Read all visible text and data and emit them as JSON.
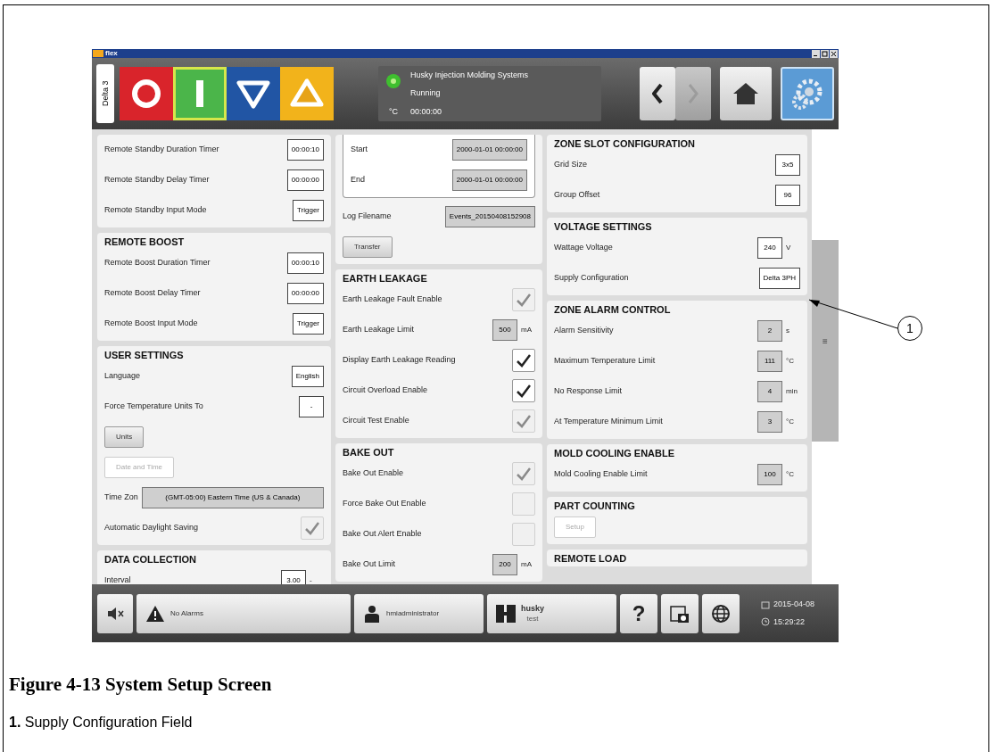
{
  "window": {
    "title": "flex",
    "controls": [
      {
        "kind": "minimize"
      },
      {
        "kind": "maximize"
      },
      {
        "kind": "close"
      }
    ]
  },
  "toolbar": {
    "machine_tab": "Delta 3",
    "mode_buttons": [
      {
        "kind": "stop",
        "selected": false
      },
      {
        "kind": "start",
        "selected": true
      },
      {
        "kind": "lower",
        "selected": false
      },
      {
        "kind": "raise",
        "selected": false
      }
    ],
    "status": {
      "led_on": true,
      "unit": "°C",
      "company": "Husky Injection Molding Systems",
      "state": "Running",
      "time": "00:00:00"
    },
    "nav_buttons": [
      {
        "kind": "back",
        "selected": false,
        "disabled": false
      },
      {
        "kind": "forward",
        "selected": false,
        "disabled": true
      },
      {
        "kind": "home",
        "selected": false,
        "disabled": false
      },
      {
        "kind": "settings",
        "selected": true,
        "disabled": false
      }
    ]
  },
  "columns": [
    {
      "sections": [
        {
          "rows": [
            {
              "kind": "field",
              "label": "Remote Standby Duration Timer",
              "value": "00:00:10",
              "readonly": false
            },
            {
              "kind": "field",
              "label": "Remote Standby Delay Timer",
              "value": "00:00:00",
              "readonly": false
            },
            {
              "kind": "field",
              "label": "Remote Standby Input Mode",
              "value": "Trigger",
              "readonly": false
            }
          ]
        },
        {
          "title": "REMOTE BOOST",
          "rows": [
            {
              "kind": "field",
              "label": "Remote Boost Duration Timer",
              "value": "00:00:10",
              "readonly": false
            },
            {
              "kind": "field",
              "label": "Remote Boost Delay Timer",
              "value": "00:00:00",
              "readonly": false
            },
            {
              "kind": "field",
              "label": "Remote Boost Input Mode",
              "value": "Trigger",
              "readonly": false
            }
          ]
        },
        {
          "title": "USER SETTINGS",
          "rows": [
            {
              "kind": "field",
              "label": "Language",
              "value": "English",
              "readonly": false
            },
            {
              "kind": "field",
              "label": "Force Temperature Units To",
              "value": "-",
              "readonly": false
            },
            {
              "kind": "button",
              "label": "Units",
              "disabled": false
            },
            {
              "kind": "button",
              "label": "Date and Time",
              "disabled": true
            },
            {
              "kind": "wide_field",
              "label": "Time Zon",
              "value": "(GMT-05:00) Eastern Time (US & Canada)",
              "readonly": true
            },
            {
              "kind": "checkbox",
              "label": "Automatic Daylight Saving",
              "checked": true,
              "disabled": true
            }
          ]
        },
        {
          "title": "DATA COLLECTION",
          "rows": [
            {
              "kind": "field",
              "label": "Interval",
              "value": "3.00",
              "unit": "-",
              "readonly": false
            }
          ]
        }
      ]
    },
    {
      "sections": [
        {
          "rows": [
            {
              "kind": "group",
              "rows": [
                {
                  "kind": "field",
                  "label": "Start",
                  "value": "2000-01-01 00:00:00",
                  "readonly": true
                },
                {
                  "kind": "field",
                  "label": "End",
                  "value": "2000-01-01 00:00:00",
                  "readonly": true
                }
              ]
            },
            {
              "kind": "field",
              "label": "Log Filename",
              "value": "Events_20150408152908",
              "readonly": true
            },
            {
              "kind": "button",
              "label": "Transfer",
              "disabled": false
            }
          ]
        },
        {
          "title": "EARTH LEAKAGE",
          "rows": [
            {
              "kind": "checkbox",
              "label": "Earth Leakage Fault Enable",
              "checked": true,
              "disabled": true
            },
            {
              "kind": "field",
              "label": "Earth Leakage Limit",
              "value": "500",
              "unit": "mA",
              "readonly": true
            },
            {
              "kind": "checkbox",
              "label": "Display Earth Leakage Reading",
              "checked": true,
              "disabled": false
            },
            {
              "kind": "checkbox",
              "label": "Circuit Overload Enable",
              "checked": true,
              "disabled": false
            },
            {
              "kind": "checkbox",
              "label": "Circuit Test Enable",
              "checked": true,
              "disabled": true
            }
          ]
        },
        {
          "title": "BAKE OUT",
          "rows": [
            {
              "kind": "checkbox",
              "label": "Bake Out Enable",
              "checked": true,
              "disabled": true
            },
            {
              "kind": "checkbox",
              "label": "Force Bake Out Enable",
              "checked": false,
              "disabled": true
            },
            {
              "kind": "checkbox",
              "label": "Bake Out Alert Enable",
              "checked": false,
              "disabled": true
            },
            {
              "kind": "field",
              "label": "Bake Out Limit",
              "value": "200",
              "unit": "mA",
              "readonly": true
            }
          ]
        }
      ]
    },
    {
      "sections": [
        {
          "title": "ZONE SLOT CONFIGURATION",
          "rows": [
            {
              "kind": "field",
              "label": "Grid Size",
              "value": "3x5",
              "readonly": false
            },
            {
              "kind": "field",
              "label": "Group Offset",
              "value": "96",
              "readonly": false
            }
          ]
        },
        {
          "title": "VOLTAGE SETTINGS",
          "rows": [
            {
              "kind": "field",
              "label": "Wattage Voltage",
              "value": "240",
              "unit": "V",
              "readonly": false
            },
            {
              "kind": "field",
              "label": "Supply Configuration",
              "value": "Delta 3PH",
              "readonly": false
            }
          ]
        },
        {
          "title": "ZONE ALARM CONTROL",
          "rows": [
            {
              "kind": "field",
              "label": "Alarm Sensitivity",
              "value": "2",
              "unit": "s",
              "readonly": true
            },
            {
              "kind": "field",
              "label": "Maximum Temperature Limit",
              "value": "111",
              "unit": "°C",
              "readonly": true
            },
            {
              "kind": "field",
              "label": "No Response Limit",
              "value": "4",
              "unit": "min",
              "readonly": true
            },
            {
              "kind": "field",
              "label": "At Temperature Minimum Limit",
              "value": "3",
              "unit": "°C",
              "readonly": true
            }
          ]
        },
        {
          "title": "MOLD COOLING ENABLE",
          "rows": [
            {
              "kind": "field",
              "label": "Mold Cooling Enable Limit",
              "value": "100",
              "unit": "°C",
              "readonly": true
            }
          ]
        },
        {
          "title": "PART COUNTING",
          "rows": [
            {
              "kind": "button",
              "label": "Setup",
              "disabled": true
            }
          ]
        },
        {
          "title": "REMOTE LOAD"
        }
      ]
    }
  ],
  "scrollbar_handle": "≡",
  "footer": {
    "alarms": "No Alarms",
    "user": "hmiadministrator",
    "machine_name": "husky",
    "machine_sub": "test",
    "help": "?",
    "date": "2015-04-08",
    "time": "15:29:22"
  },
  "callout": {
    "number": "1"
  },
  "caption": {
    "title": "Figure 4-13 System Setup Screen",
    "items": [
      "**1.** Supply Configuration Field"
    ]
  }
}
